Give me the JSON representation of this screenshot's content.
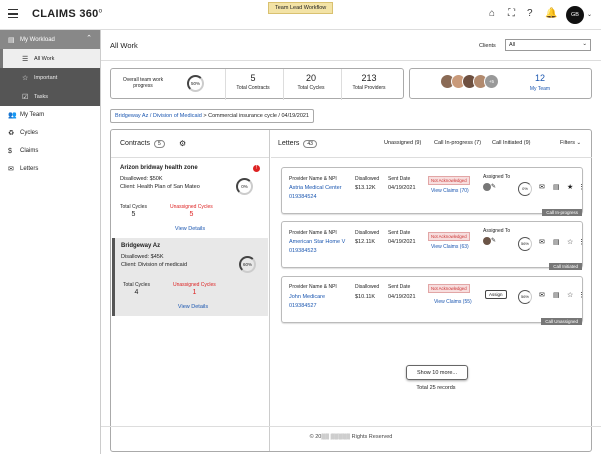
{
  "app": {
    "title": "CLAIMS 360",
    "logo_mark": "o",
    "workflow_badge": "Team Lead Workflow",
    "avatar": "GB"
  },
  "topbar": {
    "icons": [
      "home-icon",
      "scan-icon",
      "help-icon",
      "bell-icon",
      "avatar-chevron-icon"
    ]
  },
  "sidebar": {
    "workload": "My Workload",
    "sub": [
      {
        "label": "All Work",
        "active": true
      },
      {
        "label": "Important"
      },
      {
        "label": "Tasks"
      }
    ],
    "items": [
      {
        "label": "My Team"
      },
      {
        "label": "Cycles"
      },
      {
        "label": "Claims"
      },
      {
        "label": "Letters"
      }
    ]
  },
  "header": {
    "title": "All Work",
    "clients_label": "Clients",
    "clients_value": "All"
  },
  "summary": {
    "progress_label": "Overall team work progress",
    "progress": "50%",
    "contracts": {
      "value": "5",
      "label": "Total Contracts"
    },
    "cycles": {
      "value": "20",
      "label": "Total Cycles"
    },
    "providers": {
      "value": "213",
      "label": "Total Providers"
    },
    "team_count": "12",
    "team_label": "My Team",
    "team_more": "+5"
  },
  "breadcrumb": {
    "part1": "Bridgeway Az / Division of Medicaid",
    "sep": ">",
    "part2": "Commercial insurance cycle / 04/19/2021"
  },
  "contracts": {
    "title": "Contracts",
    "count": "5",
    "cards": [
      {
        "name": "Arizon bridway health zone",
        "badge": "!",
        "disallowed": "Disallowed: $50K",
        "client": "Client: Health Plan of San Mateo",
        "progress": "0%",
        "total_label": "Total Cycles",
        "total": "5",
        "unassigned_label": "Unassigned Cycles",
        "unassigned": "5",
        "view": "View Details"
      },
      {
        "name": "Bridgeway Az",
        "disallowed": "Disallowed: $45K",
        "client": "Client: Division of medicaid",
        "progress": "60%",
        "total_label": "Total Cycles",
        "total": "4",
        "unassigned_label": "Unassigned Cycles",
        "unassigned": "1",
        "view": "View Details"
      }
    ]
  },
  "letters": {
    "title": "Letters",
    "count": "43",
    "tabs": [
      "Unassigned (9)",
      "Call In-progress (7)",
      "Call Initiated (9)"
    ],
    "filters": "Filters",
    "hdr": {
      "provider": "Provider Name & NPI",
      "disallowed": "Disallowed",
      "sent": "Sent Date",
      "assigned": "Assigned To"
    },
    "rows": [
      {
        "provider": "Astria Medical Center",
        "npi": "019384524",
        "disallowed": "$13.12K",
        "sent": "04/19/2021",
        "status": "Not Acknowledged",
        "view": "View Claims (70)",
        "progress": "0%",
        "tag": "Call In-progress"
      },
      {
        "provider": "American Star Home V",
        "npi": "019384523",
        "disallowed": "$12.11K",
        "sent": "04/19/2021",
        "status": "Not Acknowledged",
        "view": "View Claims (63)",
        "progress": "56%",
        "tag": "Call Initiated"
      },
      {
        "provider": "John Medicare",
        "npi": "019384527",
        "disallowed": "$10.11K",
        "sent": "04/19/2021",
        "status": "Not Acknowledged",
        "view": "View Claims (55)",
        "assign": "Assign",
        "progress": "56%",
        "tag": "Call Unassigned"
      }
    ],
    "show_more": "Show 10 more...",
    "total": "Total 25  records"
  },
  "footer": "© 20▒▒ ▒▒▒▒▒ Rights Reserved"
}
